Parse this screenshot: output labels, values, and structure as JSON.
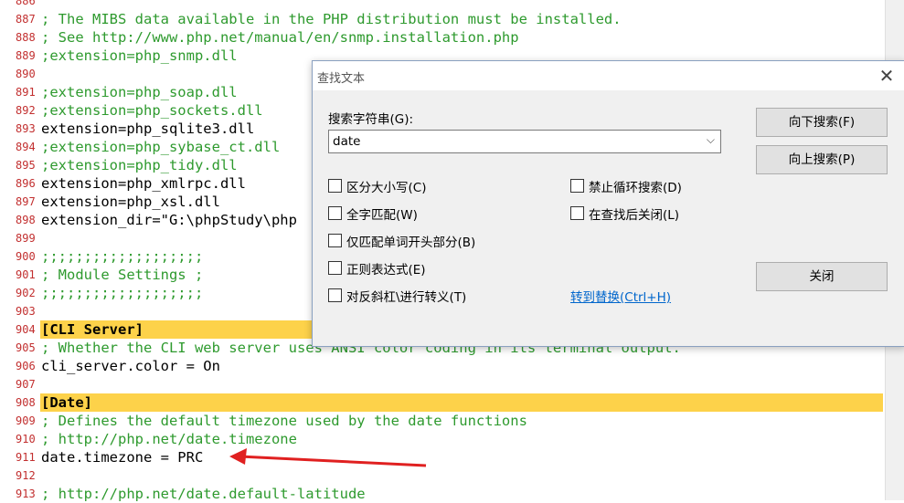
{
  "editor": {
    "lines": [
      {
        "num": "886",
        "text": "",
        "kind": "normal"
      },
      {
        "num": "887",
        "text": "; The MIBS data available in the PHP distribution must be installed.",
        "kind": "comment"
      },
      {
        "num": "888",
        "text": "; See http://www.php.net/manual/en/snmp.installation.php",
        "kind": "comment"
      },
      {
        "num": "889",
        "text": ";extension=php_snmp.dll",
        "kind": "comment"
      },
      {
        "num": "890",
        "text": "",
        "kind": "normal"
      },
      {
        "num": "891",
        "text": ";extension=php_soap.dll",
        "kind": "comment"
      },
      {
        "num": "892",
        "text": ";extension=php_sockets.dll",
        "kind": "comment"
      },
      {
        "num": "893",
        "text": "extension=php_sqlite3.dll",
        "kind": "normal"
      },
      {
        "num": "894",
        "text": ";extension=php_sybase_ct.dll",
        "kind": "comment"
      },
      {
        "num": "895",
        "text": ";extension=php_tidy.dll",
        "kind": "comment"
      },
      {
        "num": "896",
        "text": "extension=php_xmlrpc.dll",
        "kind": "normal"
      },
      {
        "num": "897",
        "text": "extension=php_xsl.dll",
        "kind": "normal"
      },
      {
        "num": "898",
        "text": "extension_dir=\"G:\\phpStudy\\php",
        "kind": "normal"
      },
      {
        "num": "899",
        "text": "",
        "kind": "normal"
      },
      {
        "num": "900",
        "text": ";;;;;;;;;;;;;;;;;;;",
        "kind": "comment"
      },
      {
        "num": "901",
        "text": "; Module Settings ;",
        "kind": "comment"
      },
      {
        "num": "902",
        "text": ";;;;;;;;;;;;;;;;;;;",
        "kind": "comment"
      },
      {
        "num": "903",
        "text": "",
        "kind": "normal"
      },
      {
        "num": "904",
        "text": "[CLI Server]",
        "kind": "section"
      },
      {
        "num": "905",
        "text": "; Whether the CLI web server uses ANSI color coding in its terminal output.",
        "kind": "comment"
      },
      {
        "num": "906",
        "text": "cli_server.color = On",
        "kind": "normal"
      },
      {
        "num": "907",
        "text": "",
        "kind": "normal"
      },
      {
        "num": "908",
        "text": "[Date]",
        "kind": "section"
      },
      {
        "num": "909",
        "text": "; Defines the default timezone used by the date functions",
        "kind": "comment"
      },
      {
        "num": "910",
        "text": "; http://php.net/date.timezone",
        "kind": "comment"
      },
      {
        "num": "911",
        "text": "date.timezone = PRC",
        "kind": "normal"
      },
      {
        "num": "912",
        "text": "",
        "kind": "normal"
      },
      {
        "num": "913",
        "text": "; http://php.net/date.default-latitude",
        "kind": "comment"
      }
    ]
  },
  "dialog": {
    "title": "查找文本",
    "close_glyph": "✕",
    "search_label": "搜索字符串(G):",
    "search_value": "date",
    "dropdown_glyph": "⌵",
    "buttons": {
      "find_down": "向下搜索(F)",
      "find_up": "向上搜索(P)",
      "close": "关闭"
    },
    "options": {
      "match_case": "区分大小写(C)",
      "whole_word": "全字匹配(W)",
      "word_start": "仅匹配单词开头部分(B)",
      "regex": "正则表达式(E)",
      "backslash_escape": "对反斜杠\\进行转义(T)",
      "no_wrap": "禁止循环搜索(D)",
      "close_after_find": "在查找后关闭(L)"
    },
    "replace_link": "转到替换(Ctrl+H)"
  },
  "colors": {
    "comment": "#2e9a2e",
    "line_number": "#c22f2f",
    "section_highlight": "#fdd24a",
    "arrow": "#e02020",
    "link": "#0066cc"
  }
}
